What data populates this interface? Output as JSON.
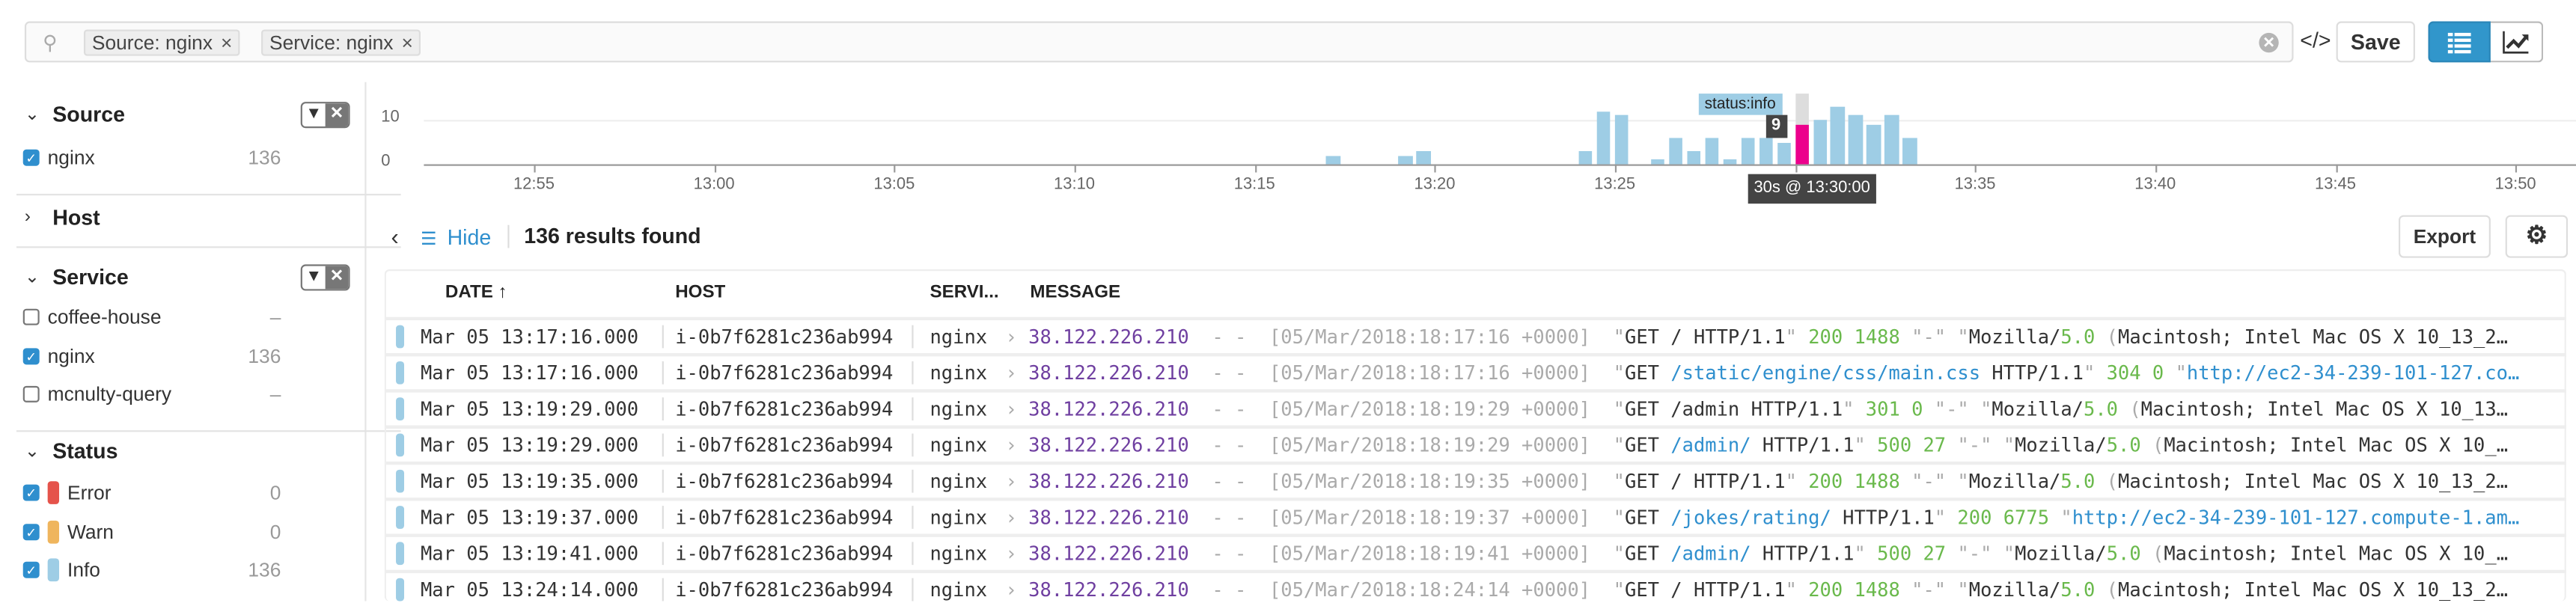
{
  "search": {
    "chips": [
      {
        "label": "Source: nginx"
      },
      {
        "label": "Service: nginx"
      }
    ],
    "close": "×"
  },
  "toolbar": {
    "code_label": "</>",
    "save_label": "Save"
  },
  "sidebar": {
    "sections": [
      {
        "title": "Source",
        "expanded": true,
        "items": [
          {
            "label": "nginx",
            "checked": true,
            "count": "136"
          }
        ]
      },
      {
        "title": "Host",
        "expanded": false,
        "items": []
      },
      {
        "title": "Service",
        "expanded": true,
        "items": [
          {
            "label": "coffee-house",
            "checked": false,
            "count": "–"
          },
          {
            "label": "nginx",
            "checked": true,
            "count": "136"
          },
          {
            "label": "mcnulty-query",
            "checked": false,
            "count": "–"
          }
        ]
      },
      {
        "title": "Status",
        "expanded": true,
        "items": [
          {
            "label": "Error",
            "checked": true,
            "count": "0",
            "color": "#e5534b"
          },
          {
            "label": "Warn",
            "checked": true,
            "count": "0",
            "color": "#efb55d"
          },
          {
            "label": "Info",
            "checked": true,
            "count": "136",
            "color": "#9ecde5"
          }
        ]
      }
    ]
  },
  "chart_data": {
    "type": "bar",
    "bin": "30s",
    "x": [
      "13:17:00",
      "13:19:00",
      "13:19:30",
      "13:24:00",
      "13:24:30",
      "13:25:00",
      "13:26:00",
      "13:26:30",
      "13:27:00",
      "13:27:30",
      "13:28:00",
      "13:28:30",
      "13:29:00",
      "13:29:30",
      "13:30:00",
      "13:30:30",
      "13:31:00",
      "13:31:30",
      "13:32:00",
      "13:32:30",
      "13:33:00"
    ],
    "values": [
      2,
      2,
      3,
      3,
      12,
      11,
      1,
      6,
      3,
      6,
      1,
      6,
      6,
      5,
      9,
      10,
      13,
      11,
      9,
      11,
      6
    ],
    "highlight": "13:30:00",
    "y_ticks": [
      "0",
      "10"
    ],
    "ylim": [
      0,
      10
    ],
    "x_ticks": [
      "12:55",
      "13:00",
      "13:05",
      "13:10",
      "13:15",
      "13:20",
      "13:25",
      "13:30",
      "13:35",
      "13:40",
      "13:45",
      "13:50"
    ],
    "tooltip": {
      "series": "status:info",
      "value": "9",
      "label": "30s @ 13:30:00"
    },
    "bar_color": "#9ecde5",
    "highlight_color": "#ec008c"
  },
  "results": {
    "back": "‹",
    "hide_label": "Hide",
    "count_text": "136 results found",
    "export_label": "Export"
  },
  "table": {
    "headers": {
      "date": "DATE ↑",
      "host": "HOST",
      "service": "SERVI...",
      "message": "MESSAGE"
    },
    "rows": [
      {
        "date": "Mar 05 13:17:16.000",
        "host": "i-0b7f6281c236ab994",
        "service": "nginx",
        "ip": "38.122.226.210",
        "ts": "[05/Mar/2018:18:17:16 +0000]",
        "msg": [
          [
            "m",
            "\""
          ],
          [
            "t",
            "GET / HTTP/1.1"
          ],
          [
            "m",
            "\""
          ],
          [
            "n",
            " 200"
          ],
          [
            "n",
            " 1488"
          ],
          [
            "m",
            " \"-\""
          ],
          [
            "m",
            " \""
          ],
          [
            "t",
            "Mozilla/"
          ],
          [
            "n",
            "5.0"
          ],
          [
            "m",
            " ("
          ],
          [
            "t",
            "Macintosh; Intel Mac OS X 10_13_2…"
          ]
        ]
      },
      {
        "date": "Mar 05 13:17:16.000",
        "host": "i-0b7f6281c236ab994",
        "service": "nginx",
        "ip": "38.122.226.210",
        "ts": "[05/Mar/2018:18:17:16 +0000]",
        "msg": [
          [
            "m",
            "\""
          ],
          [
            "t",
            "GET "
          ],
          [
            "p",
            "/static/engine/css/main.css"
          ],
          [
            "t",
            " HTTP/1.1"
          ],
          [
            "m",
            "\""
          ],
          [
            "n",
            " 304"
          ],
          [
            "n",
            " 0"
          ],
          [
            "m",
            " \""
          ],
          [
            "p",
            "http://ec2-34-239-101-127.co…"
          ]
        ]
      },
      {
        "date": "Mar 05 13:19:29.000",
        "host": "i-0b7f6281c236ab994",
        "service": "nginx",
        "ip": "38.122.226.210",
        "ts": "[05/Mar/2018:18:19:29 +0000]",
        "msg": [
          [
            "m",
            "\""
          ],
          [
            "t",
            "GET /admin HTTP/1.1"
          ],
          [
            "m",
            "\""
          ],
          [
            "n",
            " 301"
          ],
          [
            "n",
            " 0"
          ],
          [
            "m",
            " \"-\""
          ],
          [
            "m",
            " \""
          ],
          [
            "t",
            "Mozilla/"
          ],
          [
            "n",
            "5.0"
          ],
          [
            "m",
            " ("
          ],
          [
            "t",
            "Macintosh; Intel Mac OS X 10_13…"
          ]
        ]
      },
      {
        "date": "Mar 05 13:19:29.000",
        "host": "i-0b7f6281c236ab994",
        "service": "nginx",
        "ip": "38.122.226.210",
        "ts": "[05/Mar/2018:18:19:29 +0000]",
        "msg": [
          [
            "m",
            "\""
          ],
          [
            "t",
            "GET "
          ],
          [
            "p",
            "/admin/"
          ],
          [
            "t",
            " HTTP/1.1"
          ],
          [
            "m",
            "\""
          ],
          [
            "n",
            " 500"
          ],
          [
            "n",
            " 27"
          ],
          [
            "m",
            " \"-\""
          ],
          [
            "m",
            " \""
          ],
          [
            "t",
            "Mozilla/"
          ],
          [
            "n",
            "5.0"
          ],
          [
            "m",
            " ("
          ],
          [
            "t",
            "Macintosh; Intel Mac OS X 10_…"
          ]
        ]
      },
      {
        "date": "Mar 05 13:19:35.000",
        "host": "i-0b7f6281c236ab994",
        "service": "nginx",
        "ip": "38.122.226.210",
        "ts": "[05/Mar/2018:18:19:35 +0000]",
        "msg": [
          [
            "m",
            "\""
          ],
          [
            "t",
            "GET / HTTP/1.1"
          ],
          [
            "m",
            "\""
          ],
          [
            "n",
            " 200"
          ],
          [
            "n",
            " 1488"
          ],
          [
            "m",
            " \"-\""
          ],
          [
            "m",
            " \""
          ],
          [
            "t",
            "Mozilla/"
          ],
          [
            "n",
            "5.0"
          ],
          [
            "m",
            " ("
          ],
          [
            "t",
            "Macintosh; Intel Mac OS X 10_13_2…"
          ]
        ]
      },
      {
        "date": "Mar 05 13:19:37.000",
        "host": "i-0b7f6281c236ab994",
        "service": "nginx",
        "ip": "38.122.226.210",
        "ts": "[05/Mar/2018:18:19:37 +0000]",
        "msg": [
          [
            "m",
            "\""
          ],
          [
            "t",
            "GET "
          ],
          [
            "p",
            "/jokes/rating/"
          ],
          [
            "t",
            " HTTP/1.1"
          ],
          [
            "m",
            "\""
          ],
          [
            "n",
            " 200"
          ],
          [
            "n",
            " 6775"
          ],
          [
            "m",
            " \""
          ],
          [
            "p",
            "http://ec2-34-239-101-127.compute-1.am…"
          ]
        ]
      },
      {
        "date": "Mar 05 13:19:41.000",
        "host": "i-0b7f6281c236ab994",
        "service": "nginx",
        "ip": "38.122.226.210",
        "ts": "[05/Mar/2018:18:19:41 +0000]",
        "msg": [
          [
            "m",
            "\""
          ],
          [
            "t",
            "GET "
          ],
          [
            "p",
            "/admin/"
          ],
          [
            "t",
            " HTTP/1.1"
          ],
          [
            "m",
            "\""
          ],
          [
            "n",
            " 500"
          ],
          [
            "n",
            " 27"
          ],
          [
            "m",
            " \"-\""
          ],
          [
            "m",
            " \""
          ],
          [
            "t",
            "Mozilla/"
          ],
          [
            "n",
            "5.0"
          ],
          [
            "m",
            " ("
          ],
          [
            "t",
            "Macintosh; Intel Mac OS X 10_…"
          ]
        ]
      },
      {
        "date": "Mar 05 13:24:14.000",
        "host": "i-0b7f6281c236ab994",
        "service": "nginx",
        "ip": "38.122.226.210",
        "ts": "[05/Mar/2018:18:24:14 +0000]",
        "msg": [
          [
            "m",
            "\""
          ],
          [
            "t",
            "GET / HTTP/1.1"
          ],
          [
            "m",
            "\""
          ],
          [
            "n",
            " 200"
          ],
          [
            "n",
            " 1488"
          ],
          [
            "m",
            " \"-\""
          ],
          [
            "m",
            " \""
          ],
          [
            "t",
            "Mozilla/"
          ],
          [
            "n",
            "5.0"
          ],
          [
            "m",
            " ("
          ],
          [
            "t",
            "Macintosh; Intel Mac OS X 10_13_2…"
          ]
        ]
      }
    ]
  }
}
